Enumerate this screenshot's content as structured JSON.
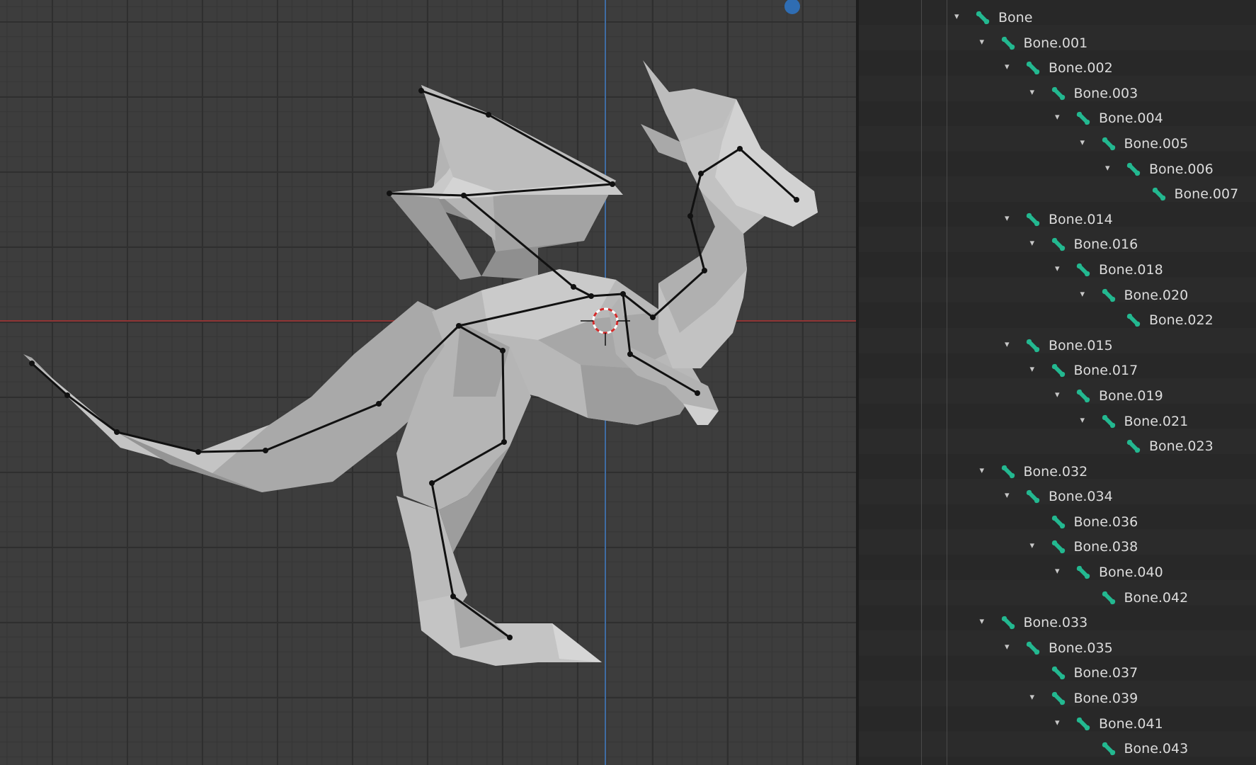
{
  "colors": {
    "bone_icon": "#23b890",
    "x_axis": "#8f3434",
    "z_axis": "#3f6ca3",
    "gizmo_dot": "#2f6db3"
  },
  "icons": {
    "expand": "▾",
    "bone": "bone-icon"
  },
  "outliner": {
    "items": [
      {
        "label": "Bone",
        "depth": 0,
        "expanded": true
      },
      {
        "label": "Bone.001",
        "depth": 1,
        "expanded": true
      },
      {
        "label": "Bone.002",
        "depth": 2,
        "expanded": true
      },
      {
        "label": "Bone.003",
        "depth": 3,
        "expanded": true
      },
      {
        "label": "Bone.004",
        "depth": 4,
        "expanded": true
      },
      {
        "label": "Bone.005",
        "depth": 5,
        "expanded": true
      },
      {
        "label": "Bone.006",
        "depth": 6,
        "expanded": true
      },
      {
        "label": "Bone.007",
        "depth": 7,
        "expanded": false
      },
      {
        "label": "Bone.014",
        "depth": 2,
        "expanded": true
      },
      {
        "label": "Bone.016",
        "depth": 3,
        "expanded": true
      },
      {
        "label": "Bone.018",
        "depth": 4,
        "expanded": true
      },
      {
        "label": "Bone.020",
        "depth": 5,
        "expanded": true
      },
      {
        "label": "Bone.022",
        "depth": 6,
        "expanded": false
      },
      {
        "label": "Bone.015",
        "depth": 2,
        "expanded": true
      },
      {
        "label": "Bone.017",
        "depth": 3,
        "expanded": true
      },
      {
        "label": "Bone.019",
        "depth": 4,
        "expanded": true
      },
      {
        "label": "Bone.021",
        "depth": 5,
        "expanded": true
      },
      {
        "label": "Bone.023",
        "depth": 6,
        "expanded": false
      },
      {
        "label": "Bone.032",
        "depth": 1,
        "expanded": true
      },
      {
        "label": "Bone.034",
        "depth": 2,
        "expanded": true
      },
      {
        "label": "Bone.036",
        "depth": 3,
        "expanded": false
      },
      {
        "label": "Bone.038",
        "depth": 3,
        "expanded": true
      },
      {
        "label": "Bone.040",
        "depth": 4,
        "expanded": true
      },
      {
        "label": "Bone.042",
        "depth": 5,
        "expanded": false
      },
      {
        "label": "Bone.033",
        "depth": 1,
        "expanded": true
      },
      {
        "label": "Bone.035",
        "depth": 2,
        "expanded": true
      },
      {
        "label": "Bone.037",
        "depth": 3,
        "expanded": false
      },
      {
        "label": "Bone.039",
        "depth": 3,
        "expanded": true
      },
      {
        "label": "Bone.041",
        "depth": 4,
        "expanded": true
      },
      {
        "label": "Bone.043",
        "depth": 5,
        "expanded": false
      }
    ]
  }
}
